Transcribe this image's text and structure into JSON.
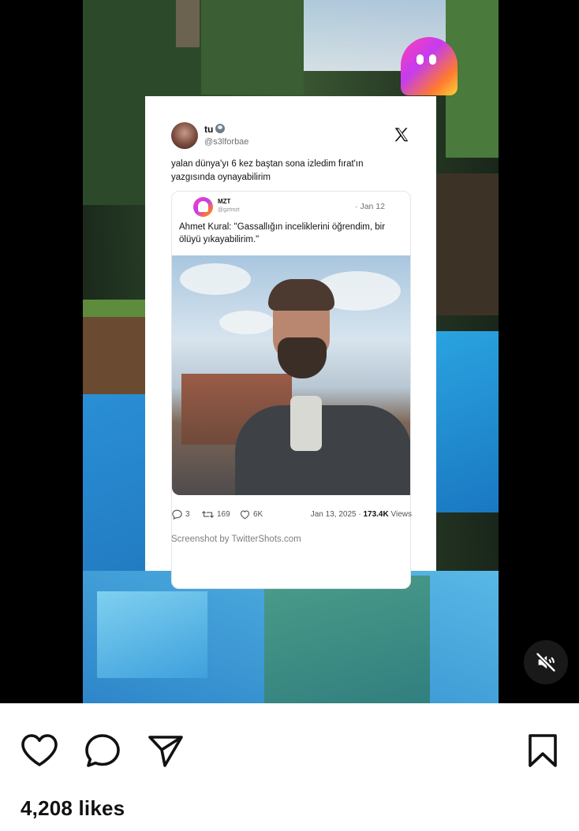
{
  "tweet": {
    "author_name": "tu",
    "author_handle": "@s3lforbae",
    "text": "yalan dünya'yı 6 kez baştan sona izledim fırat'ın yazgısında oynayabilirim",
    "quote": {
      "name": "MZT",
      "handle": "@gztmzt",
      "date": "· Jan 12",
      "text": "Ahmet Kural: \"Gassallığın inceliklerini öğrendim, bir ölüyü yıkayabilirim.\""
    },
    "replies": "3",
    "retweets": "169",
    "likes": "6K",
    "date": "Jan 13, 2025 · ",
    "views_count": "173.4K",
    "views_label": " Views",
    "credit": "Screenshot by TwitterShots.com"
  },
  "post": {
    "likes_text": "4,208 likes"
  },
  "icons": {
    "like": "heart-icon",
    "comment": "comment-icon",
    "share": "send-icon",
    "save": "bookmark-icon",
    "mute": "speaker-muted-icon",
    "x_logo": "x-logo-icon",
    "ghost": "ghost-logo-icon"
  },
  "colors": {
    "accent_gradient_start": "#ff3fb0",
    "accent_gradient_end": "#ffd23a"
  }
}
